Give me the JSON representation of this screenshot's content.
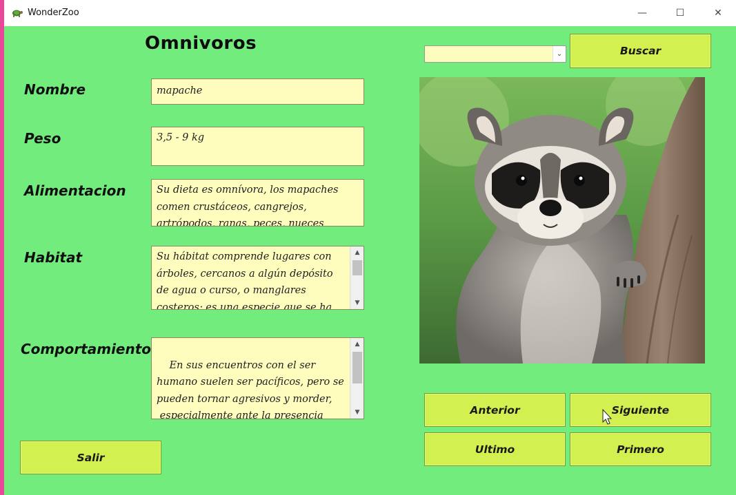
{
  "window": {
    "title": "WonderZoo",
    "controls": {
      "minimize": "—",
      "maximize": "☐",
      "close": "✕"
    }
  },
  "form": {
    "title": "Omnivoros",
    "labels": {
      "nombre": "Nombre",
      "peso": "Peso",
      "alimentacion": "Alimentacion",
      "habitat": "Habitat",
      "comportamiento": "Comportamiento"
    },
    "fields": {
      "nombre": "mapache",
      "peso": "3,5 - 9 kg",
      "alimentacion": "Su dieta es omnívora, los mapaches comen crustáceos, cangrejos, artrópodos, ranas, peces, nueces",
      "habitat": "Su hábitat comprende lugares con árboles, cercanos a algún depósito de agua o curso, o manglares costeros; es una especie que se ha",
      "comportamiento": "En sus encuentros con el ser humano suelen ser pacíficos, pero se pueden tornar agresivos y morder,\n especialmente ante la presencia"
    }
  },
  "search": {
    "combo_value": "",
    "button_label": "Buscar"
  },
  "nav": {
    "anterior": "Anterior",
    "siguiente": "Siguiente",
    "ultimo": "Ultimo",
    "primero": "Primero"
  },
  "exit_label": "Salir",
  "photo": {
    "subject": "raccoon-photo"
  },
  "colors": {
    "window_bg": "#72ec7c",
    "field_bg": "#fffdbd",
    "button_bg": "#d3f051"
  }
}
